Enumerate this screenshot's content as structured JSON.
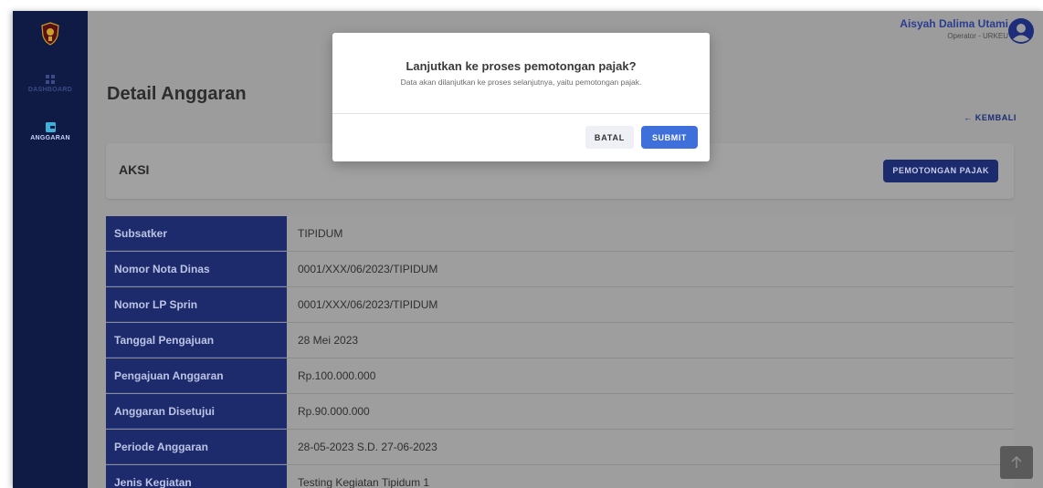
{
  "sidebar": {
    "items": [
      {
        "label": "DASHBOARD",
        "icon": "dashboard-grid-icon"
      },
      {
        "label": "ANGGARAN",
        "icon": "wallet-icon"
      }
    ]
  },
  "header": {
    "user_name": "Aisyah Dalima Utami",
    "user_role": "Operator - URKEU"
  },
  "page": {
    "title": "Detail Anggaran",
    "back_label": "← KEMBALI"
  },
  "aksi": {
    "title": "AKSI",
    "button_label": "PEMOTONGAN PAJAK"
  },
  "details": [
    {
      "label": "Subsatker",
      "value": "TIPIDUM"
    },
    {
      "label": "Nomor Nota Dinas",
      "value": "0001/XXX/06/2023/TIPIDUM"
    },
    {
      "label": "Nomor LP Sprin",
      "value": "0001/XXX/06/2023/TIPIDUM"
    },
    {
      "label": "Tanggal Pengajuan",
      "value": "28 Mei 2023"
    },
    {
      "label": "Pengajuan Anggaran",
      "value": "Rp.100.000.000"
    },
    {
      "label": "Anggaran Disetujui",
      "value": "Rp.90.000.000"
    },
    {
      "label": "Periode Anggaran",
      "value": "28-05-2023 S.D. 27-06-2023"
    },
    {
      "label": "Jenis Kegiatan",
      "value": "Testing Kegiatan Tipidum 1"
    }
  ],
  "modal": {
    "title": "Lanjutkan ke proses pemotongan pajak?",
    "subtitle": "Data akan dilanjutkan ke proses selanjutnya, yaitu pemotongan pajak.",
    "cancel_label": "BATAL",
    "submit_label": "SUBMIT"
  },
  "colors": {
    "sidebar": "#0f1a45",
    "label_cell": "#1d2a6c",
    "submit": "#3e6fdb",
    "overlay": "#9c9c9c"
  }
}
